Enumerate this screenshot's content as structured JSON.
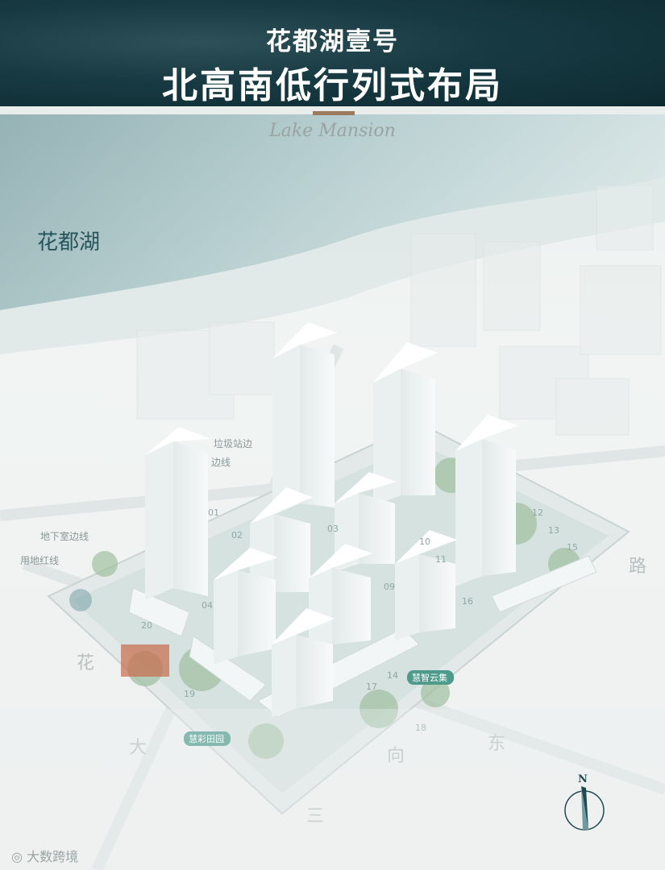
{
  "header": {
    "title": "花都湖壹号",
    "subtitle": "北高南低行列式布局",
    "brand_script": "Lake Mansion"
  },
  "map": {
    "lake_label": "花都湖",
    "road_labels": [
      "花",
      "东",
      "路",
      "大",
      "三",
      "向"
    ],
    "line_labels": {
      "basement_edge": "地下室边线",
      "red_line": "用地红线",
      "garbage_edge": "垃圾站边",
      "edge_line": "边线"
    },
    "amenity_tags": [
      "慧智云集",
      "慧彩田园"
    ],
    "gate_numbers": [
      "01",
      "02",
      "03",
      "04",
      "09",
      "10",
      "11",
      "12",
      "13",
      "14",
      "15",
      "16",
      "17",
      "18",
      "19",
      "20"
    ]
  },
  "compass": {
    "label": "N"
  },
  "watermark": {
    "text": "大数跨境"
  },
  "colors": {
    "header_dark": "#173a42",
    "lake": "#6f9aa0",
    "accent": "#9b7a60",
    "tower": "#f7f9f9",
    "green_tag": "#4e9b8c"
  }
}
